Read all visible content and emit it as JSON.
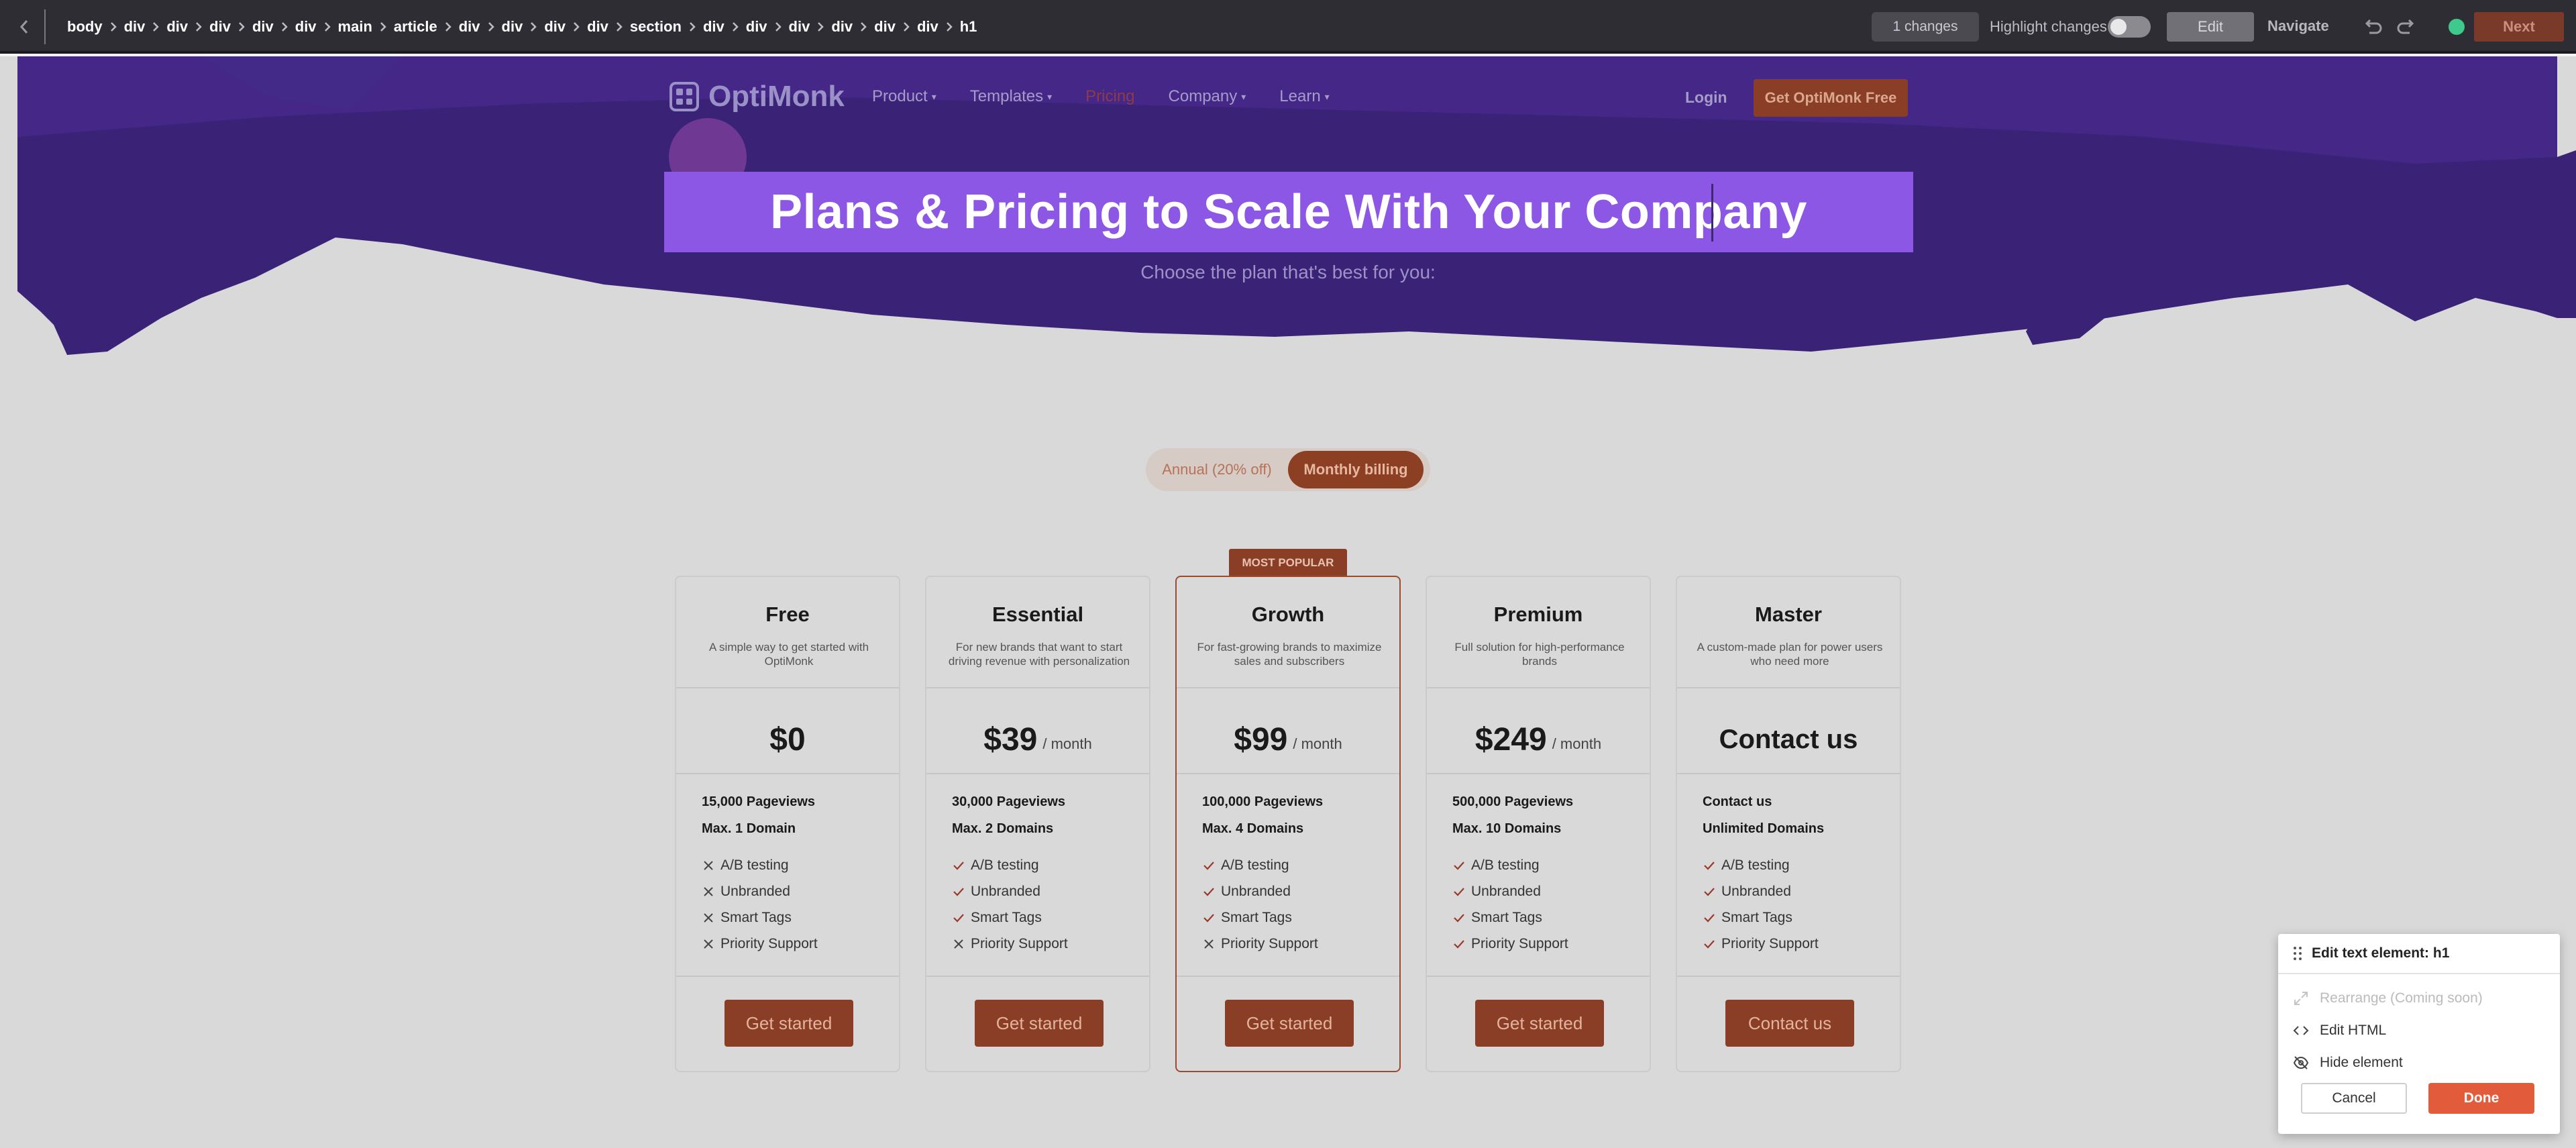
{
  "toolbar": {
    "breadcrumbs": [
      "body",
      "div",
      "div",
      "div",
      "div",
      "div",
      "main",
      "article",
      "div",
      "div",
      "div",
      "div",
      "section",
      "div",
      "div",
      "div",
      "div",
      "div",
      "div",
      "h1"
    ],
    "changes": "1 changes",
    "highlight_label": "Highlight changes",
    "edit_label": "Edit",
    "navigate_label": "Navigate",
    "next_label": "Next",
    "status_color": "#3ec98d"
  },
  "site": {
    "logo": "OptiMonk",
    "nav": [
      {
        "label": "Product",
        "dropdown": true
      },
      {
        "label": "Templates",
        "dropdown": true
      },
      {
        "label": "Pricing",
        "dropdown": false
      },
      {
        "label": "Company",
        "dropdown": true
      },
      {
        "label": "Learn",
        "dropdown": true
      }
    ],
    "login": "Login",
    "cta": "Get OptiMonk Free",
    "heading": "Plans & Pricing to Scale With Your Company",
    "subtitle": "Choose the plan that's best for you:",
    "billing": {
      "annual": "Annual (20% off)",
      "monthly": "Monthly billing",
      "selected": "monthly"
    },
    "popular_badge": "MOST POPULAR",
    "plans": [
      {
        "name": "Free",
        "desc": "A simple way to get started with OptiMonk",
        "price": "$0",
        "per": "",
        "pageviews": "15,000 Pageviews",
        "domains": "Max. 1 Domain",
        "features": [
          {
            "label": "A/B testing",
            "included": false
          },
          {
            "label": "Unbranded",
            "included": false
          },
          {
            "label": "Smart Tags",
            "included": false
          },
          {
            "label": "Priority Support",
            "included": false
          }
        ],
        "button": "Get started"
      },
      {
        "name": "Essential",
        "desc": "For new brands that want to start driving revenue with personalization",
        "price": "$39",
        "per": "/ month",
        "pageviews": "30,000 Pageviews",
        "domains": "Max. 2 Domains",
        "features": [
          {
            "label": "A/B testing",
            "included": true
          },
          {
            "label": "Unbranded",
            "included": true
          },
          {
            "label": "Smart Tags",
            "included": true
          },
          {
            "label": "Priority Support",
            "included": false
          }
        ],
        "button": "Get started"
      },
      {
        "name": "Growth",
        "desc": "For fast-growing brands to maximize sales and subscribers",
        "price": "$99",
        "per": "/ month",
        "pageviews": "100,000 Pageviews",
        "domains": "Max. 4 Domains",
        "features": [
          {
            "label": "A/B testing",
            "included": true
          },
          {
            "label": "Unbranded",
            "included": true
          },
          {
            "label": "Smart Tags",
            "included": true
          },
          {
            "label": "Priority Support",
            "included": false
          }
        ],
        "button": "Get started"
      },
      {
        "name": "Premium",
        "desc": "Full solution for high-performance brands",
        "price": "$249",
        "per": "/ month",
        "pageviews": "500,000 Pageviews",
        "domains": "Max. 10 Domains",
        "features": [
          {
            "label": "A/B testing",
            "included": true
          },
          {
            "label": "Unbranded",
            "included": true
          },
          {
            "label": "Smart Tags",
            "included": true
          },
          {
            "label": "Priority Support",
            "included": true
          }
        ],
        "button": "Get started"
      },
      {
        "name": "Master",
        "desc": "A custom-made plan for power users who need more",
        "price": "Contact us",
        "per": "",
        "pageviews": "Contact us",
        "domains": "Unlimited Domains",
        "features": [
          {
            "label": "A/B testing",
            "included": true
          },
          {
            "label": "Unbranded",
            "included": true
          },
          {
            "label": "Smart Tags",
            "included": true
          },
          {
            "label": "Priority Support",
            "included": true
          }
        ],
        "button": "Contact us"
      }
    ]
  },
  "panel": {
    "title": "Edit text element: h1",
    "rearrange": "Rearrange (Coming soon)",
    "edit_html": "Edit HTML",
    "hide": "Hide element",
    "cancel": "Cancel",
    "done": "Done"
  }
}
